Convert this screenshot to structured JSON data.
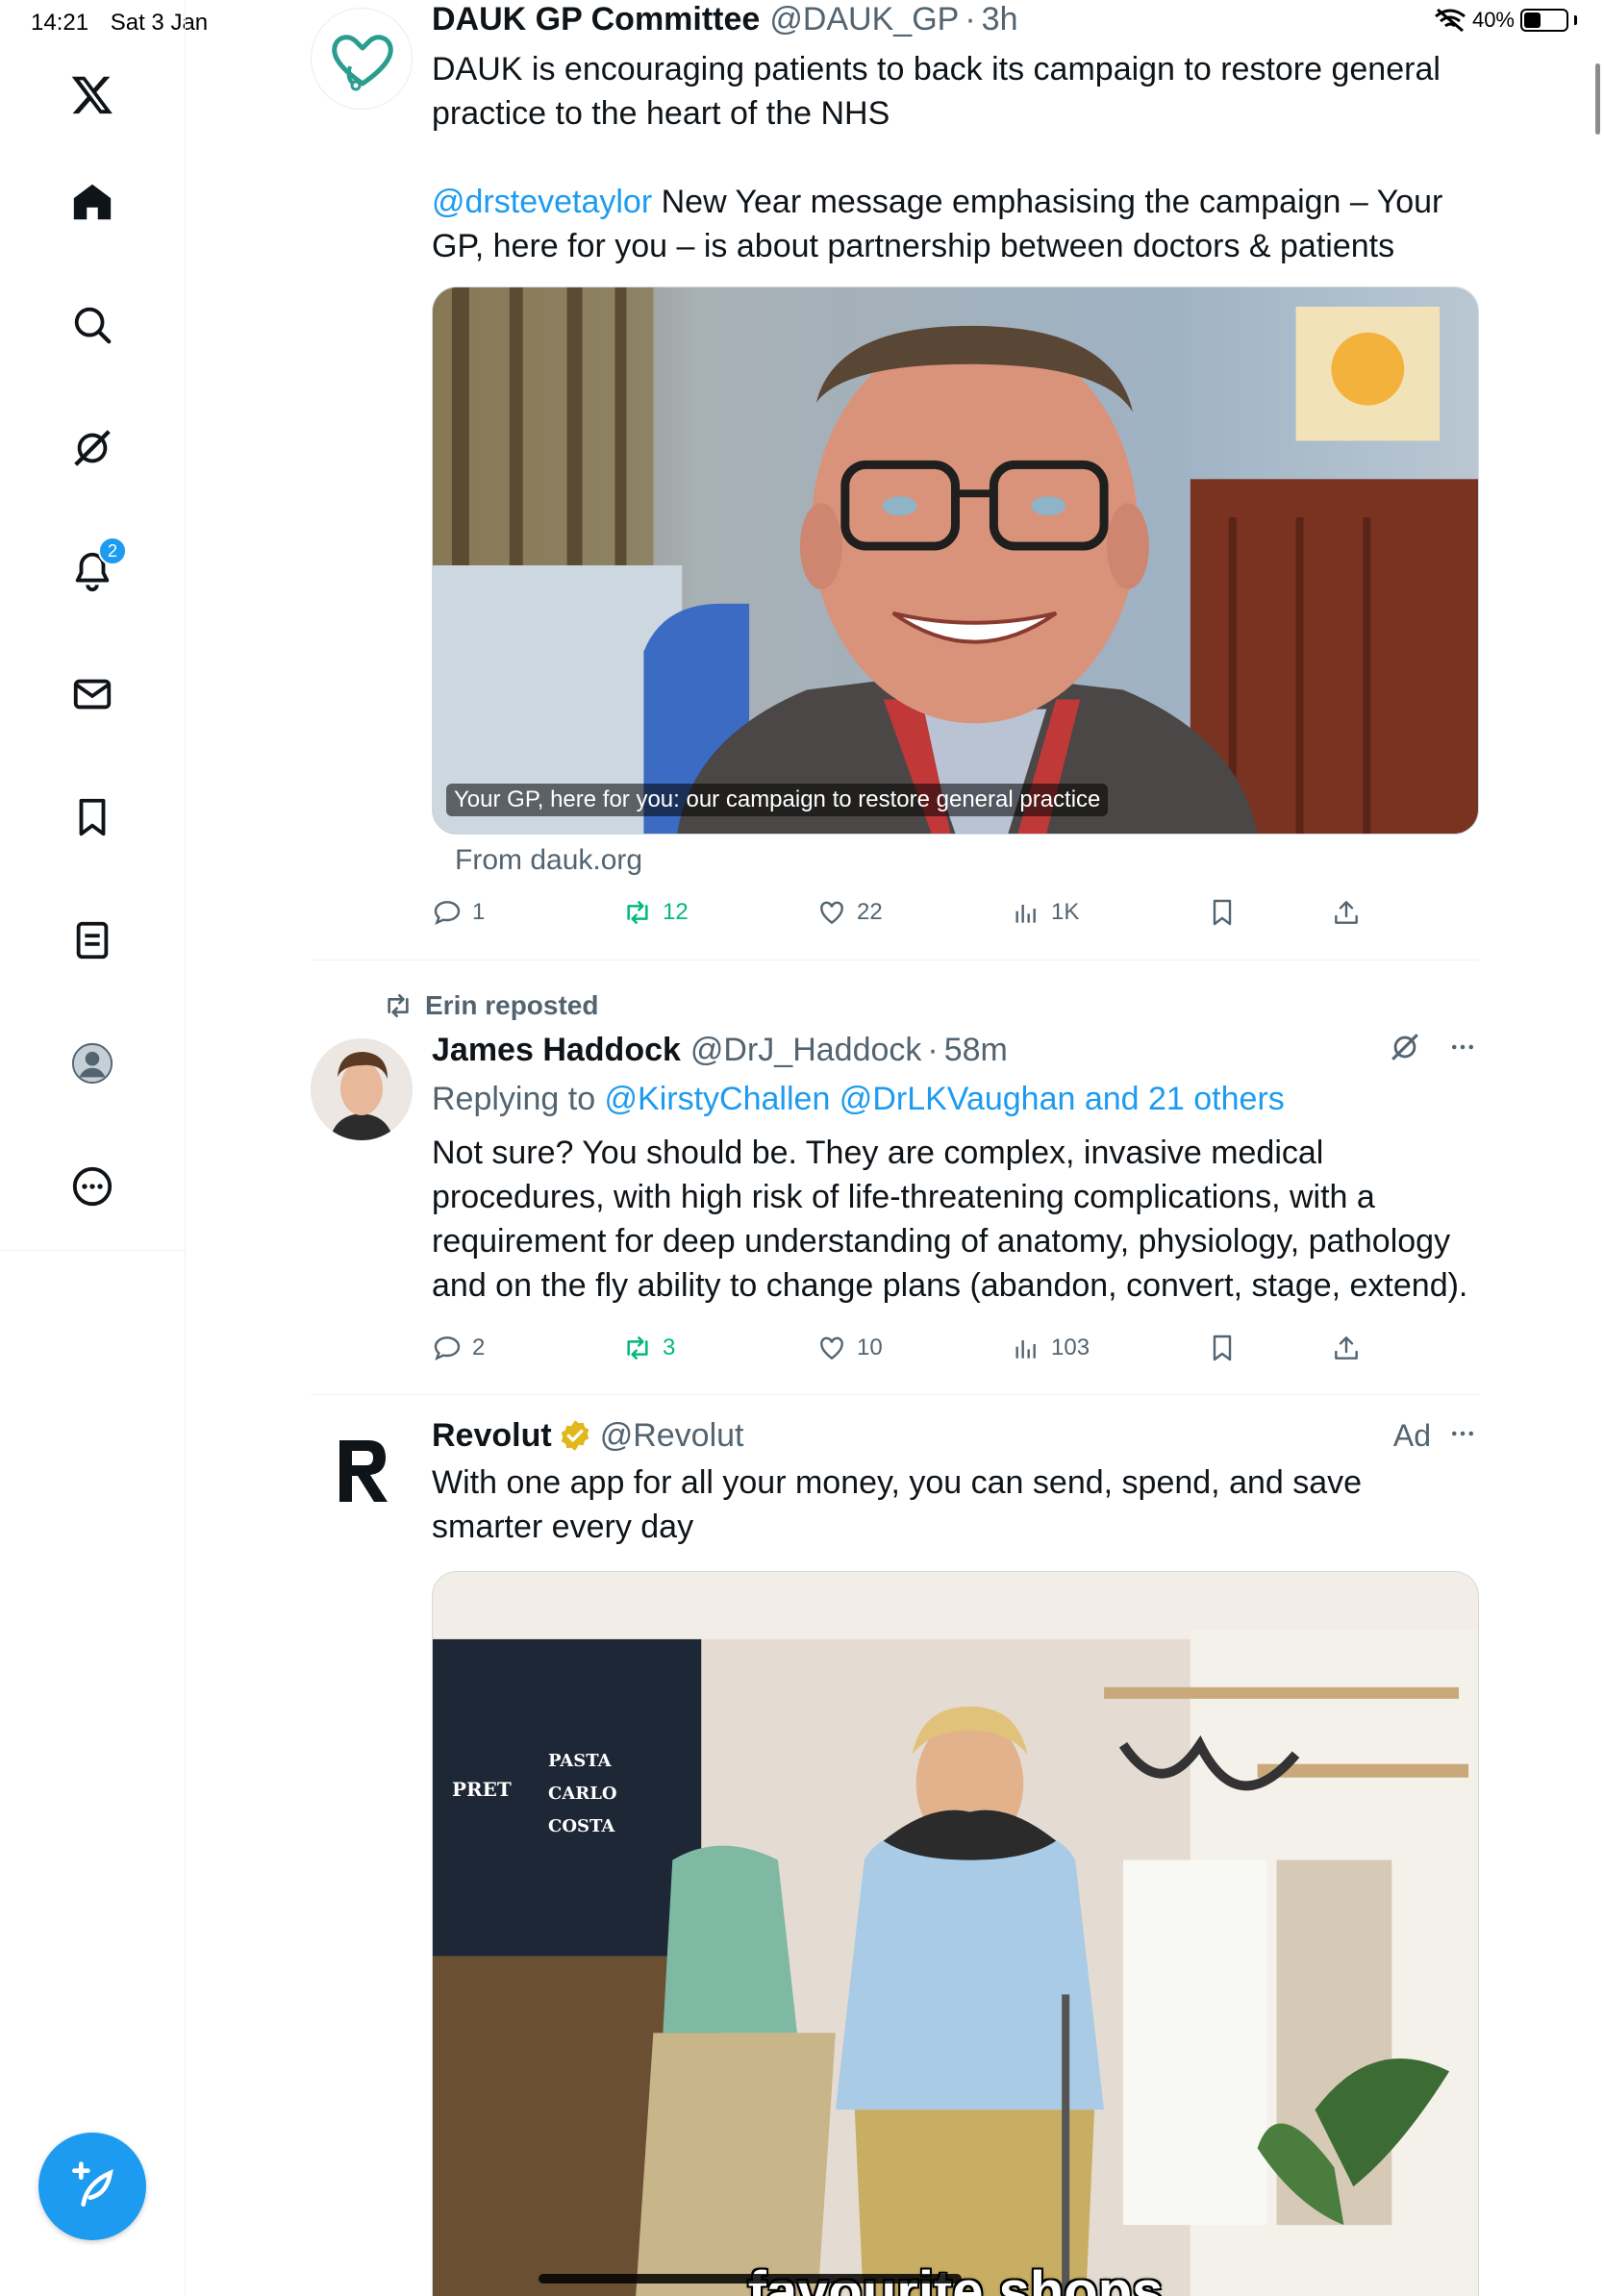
{
  "status_bar": {
    "time": "14:21",
    "date": "Sat 3 Jan",
    "battery": "40%",
    "battery_level": 0.4
  },
  "sidebar": {
    "items": [
      {
        "name": "x-logo"
      },
      {
        "name": "home"
      },
      {
        "name": "explore"
      },
      {
        "name": "grok"
      },
      {
        "name": "notifications",
        "badge": "2"
      },
      {
        "name": "messages"
      },
      {
        "name": "bookmarks"
      },
      {
        "name": "lists"
      },
      {
        "name": "profile"
      },
      {
        "name": "more"
      }
    ],
    "compose_icon": "compose-post-icon"
  },
  "posts": [
    {
      "author_name": "DAUK GP Committee",
      "handle": "@DAUK_GP",
      "dot": "·",
      "time": "3h",
      "text_1": "DAUK is encouraging patients to back its campaign to restore general practice to the heart of the NHS",
      "mention": "@drstevetaylor",
      "text_2": " New Year message emphasising the campaign – Your GP, here for you – is about partnership between doctors & patients",
      "media_caption": "Your GP, here for you: our campaign to restore general practice",
      "link_source": "From dauk.org",
      "replies": "1",
      "reposts": "12",
      "likes": "22",
      "views": "1K"
    },
    {
      "repost_label": "Erin reposted",
      "author_name": "James Haddock",
      "handle": "@DrJ_Haddock",
      "dot": "·",
      "time": "58m",
      "replying_prefix": "Replying to ",
      "replying_to": "@KirstyChallen @DrLKVaughan and 21 others",
      "text": "Not sure? You should be. They are complex, invasive medical procedures, with high risk of life-threatening complications, with a requirement for deep understanding of anatomy, physiology, pathology and on the fly ability to change plans (abandon, convert, stage, extend).",
      "replies": "2",
      "reposts": "3",
      "likes": "10",
      "views": "103"
    },
    {
      "author_name": "Revolut",
      "handle": "@Revolut",
      "ad_label": "Ad",
      "text": "With one app for all your money, you can send, spend, and save smarter every day",
      "video_caption": "favourite shops",
      "store_signs": [
        "PASTA",
        "CARLO",
        "COSTA",
        "PRET"
      ]
    }
  ],
  "colors": {
    "accent": "#1d9bf0",
    "repost": "#00ba7c",
    "muted": "#536471",
    "teal_logo": "#2a9d8f"
  }
}
